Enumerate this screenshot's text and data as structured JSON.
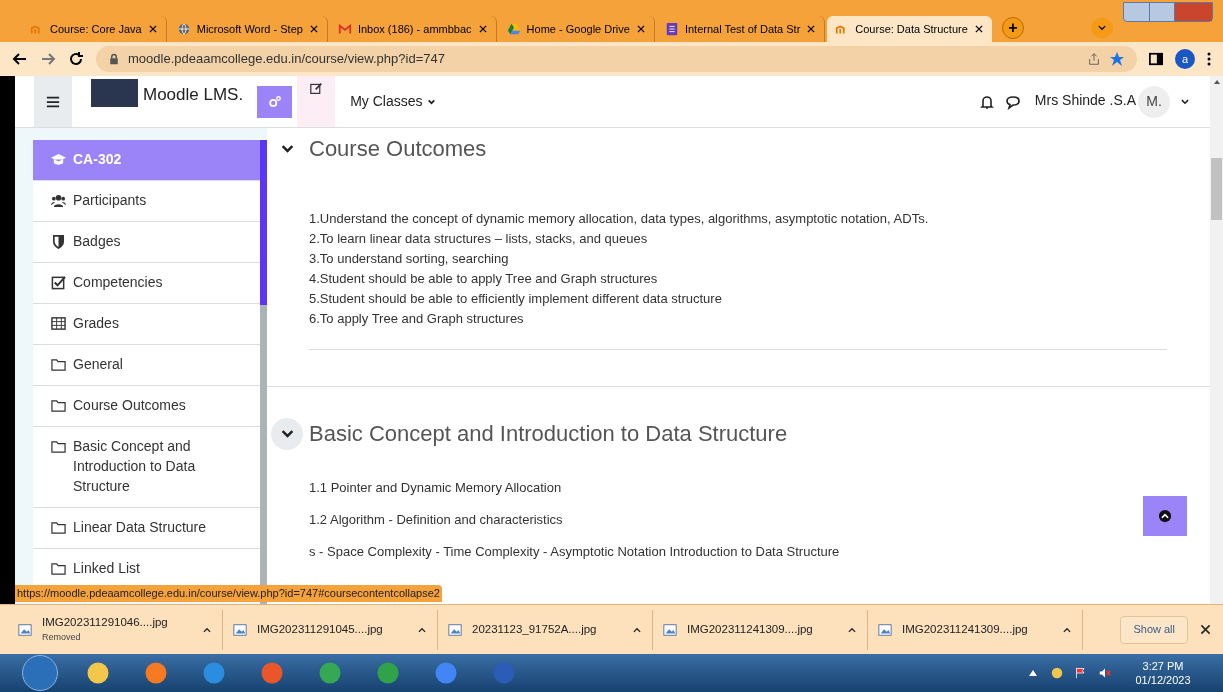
{
  "browser": {
    "tabs": [
      {
        "label": "Course: Core Java",
        "selected": false
      },
      {
        "label": "Microsoft Word - Step",
        "selected": false
      },
      {
        "label": "Inbox (186) - ammbbac",
        "selected": false
      },
      {
        "label": "Home - Google Drive",
        "selected": false
      },
      {
        "label": "Internal Test of Data Str",
        "selected": false
      },
      {
        "label": "Course: Data Structure",
        "selected": true
      }
    ],
    "new_tab": "+",
    "address": "moodle.pdeaamcollege.edu.in/course/view.php?id=747",
    "profile": "a"
  },
  "header": {
    "site_name": "Moodle LMS.",
    "nav": "My Classes",
    "user": "Mrs Shinde .S.A",
    "avatar": "M."
  },
  "sidebar": {
    "items": [
      {
        "label": "CA-302",
        "selected": true
      },
      {
        "label": "Participants",
        "selected": false
      },
      {
        "label": "Badges",
        "selected": false
      },
      {
        "label": "Competencies",
        "selected": false
      },
      {
        "label": "Grades",
        "selected": false
      },
      {
        "label": "General",
        "selected": false
      },
      {
        "label": "Course Outcomes",
        "selected": false
      },
      {
        "label": "Basic Concept and Introduction to Data Structure",
        "selected": false
      },
      {
        "label": "Linear Data Structure",
        "selected": false
      },
      {
        "label": "Linked List",
        "selected": false
      }
    ]
  },
  "sections": [
    {
      "title": "Course Outcomes",
      "expanded": true,
      "lines": [
        "1.Understand the concept of dynamic memory allocation, data types, algorithms, asymptotic notation, ADTs.",
        "2.To learn linear data structures – lists, stacks, and queues",
        "3.To understand sorting, searching",
        "4.Student should be able to apply Tree and Graph structures",
        "5.Student should be able to efficiently implement different data structure",
        "6.To apply Tree and Graph structures"
      ]
    },
    {
      "title": "Basic Concept and Introduction to Data Structure",
      "expanded": true,
      "lines": [
        "1.1 Pointer and Dynamic Memory Allocation",
        "1.2 Algorithm - Definition and characteristics",
        "s - Space Complexity - Time Complexity - Asymptotic Notation Introduction to Data Structure"
      ]
    }
  ],
  "status_url": "https://moodle.pdeaamcollege.edu.in/course/view.php?id=747#coursecontentcollapse2",
  "downloads": {
    "items": [
      {
        "name": "IMG202311291046....jpg",
        "note": "Removed"
      },
      {
        "name": "IMG202311291045....jpg"
      },
      {
        "name": "20231123_91752A....jpg"
      },
      {
        "name": "IMG202311241309....jpg"
      },
      {
        "name": "IMG202311241309....jpg"
      }
    ],
    "show_all": "Show all"
  },
  "taskbar": {
    "time": "3:27 PM",
    "date": "01/12/2023"
  }
}
